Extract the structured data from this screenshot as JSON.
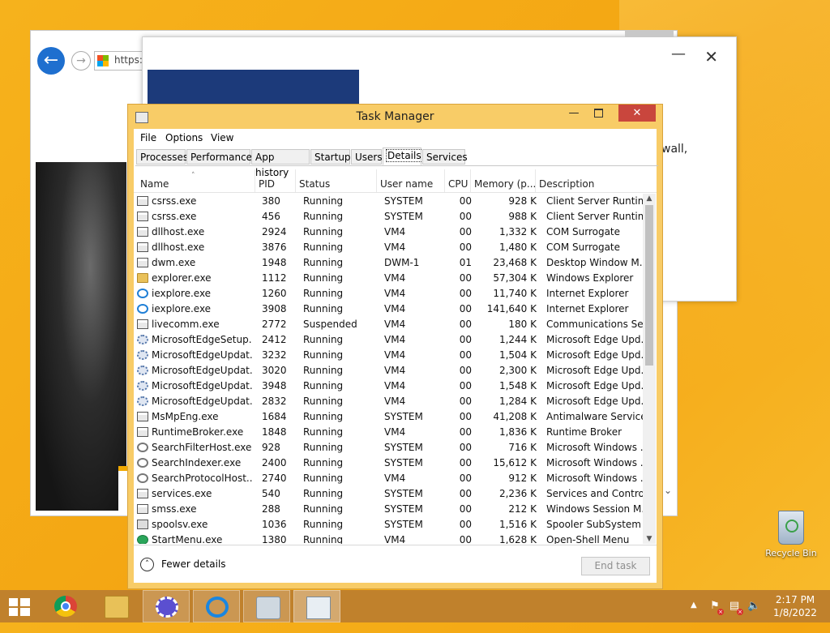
{
  "browser": {
    "address_text": "https:/",
    "dialog_snippet_text": "wall,"
  },
  "task_manager": {
    "title": "Task Manager",
    "menu": [
      "File",
      "Options",
      "View"
    ],
    "tabs": [
      "Processes",
      "Performance",
      "App history",
      "Startup",
      "Users",
      "Details",
      "Services"
    ],
    "active_tab": "Details",
    "columns": [
      "Name",
      "PID",
      "Status",
      "User name",
      "CPU",
      "Memory (p...",
      "Description"
    ],
    "rows": [
      {
        "name": "csrss.exe",
        "icon": "exe",
        "pid": "380",
        "status": "Running",
        "user": "SYSTEM",
        "cpu": "00",
        "mem": "928 K",
        "desc": "Client Server Runtim..."
      },
      {
        "name": "csrss.exe",
        "icon": "exe",
        "pid": "456",
        "status": "Running",
        "user": "SYSTEM",
        "cpu": "00",
        "mem": "988 K",
        "desc": "Client Server Runtim..."
      },
      {
        "name": "dllhost.exe",
        "icon": "exe",
        "pid": "2924",
        "status": "Running",
        "user": "VM4",
        "cpu": "00",
        "mem": "1,332 K",
        "desc": "COM Surrogate"
      },
      {
        "name": "dllhost.exe",
        "icon": "exe",
        "pid": "3876",
        "status": "Running",
        "user": "VM4",
        "cpu": "00",
        "mem": "1,480 K",
        "desc": "COM Surrogate"
      },
      {
        "name": "dwm.exe",
        "icon": "exe",
        "pid": "1948",
        "status": "Running",
        "user": "DWM-1",
        "cpu": "01",
        "mem": "23,468 K",
        "desc": "Desktop Window M..."
      },
      {
        "name": "explorer.exe",
        "icon": "folder",
        "pid": "1112",
        "status": "Running",
        "user": "VM4",
        "cpu": "00",
        "mem": "57,304 K",
        "desc": "Windows Explorer"
      },
      {
        "name": "iexplore.exe",
        "icon": "ie",
        "pid": "1260",
        "status": "Running",
        "user": "VM4",
        "cpu": "00",
        "mem": "11,740 K",
        "desc": "Internet Explorer"
      },
      {
        "name": "iexplore.exe",
        "icon": "ie",
        "pid": "3908",
        "status": "Running",
        "user": "VM4",
        "cpu": "00",
        "mem": "141,640 K",
        "desc": "Internet Explorer"
      },
      {
        "name": "livecomm.exe",
        "icon": "exe",
        "pid": "2772",
        "status": "Suspended",
        "user": "VM4",
        "cpu": "00",
        "mem": "180 K",
        "desc": "Communications Se..."
      },
      {
        "name": "MicrosoftEdgeSetup....",
        "icon": "gear",
        "pid": "2412",
        "status": "Running",
        "user": "VM4",
        "cpu": "00",
        "mem": "1,244 K",
        "desc": "Microsoft Edge Upd..."
      },
      {
        "name": "MicrosoftEdgeUpdat...",
        "icon": "gear",
        "pid": "3232",
        "status": "Running",
        "user": "VM4",
        "cpu": "00",
        "mem": "1,504 K",
        "desc": "Microsoft Edge Upd..."
      },
      {
        "name": "MicrosoftEdgeUpdat...",
        "icon": "gear",
        "pid": "3020",
        "status": "Running",
        "user": "VM4",
        "cpu": "00",
        "mem": "2,300 K",
        "desc": "Microsoft Edge Upd..."
      },
      {
        "name": "MicrosoftEdgeUpdat...",
        "icon": "gear",
        "pid": "3948",
        "status": "Running",
        "user": "VM4",
        "cpu": "00",
        "mem": "1,548 K",
        "desc": "Microsoft Edge Upd..."
      },
      {
        "name": "MicrosoftEdgeUpdat...",
        "icon": "gear",
        "pid": "2832",
        "status": "Running",
        "user": "VM4",
        "cpu": "00",
        "mem": "1,284 K",
        "desc": "Microsoft Edge Upd..."
      },
      {
        "name": "MsMpEng.exe",
        "icon": "exe",
        "pid": "1684",
        "status": "Running",
        "user": "SYSTEM",
        "cpu": "00",
        "mem": "41,208 K",
        "desc": "Antimalware Service..."
      },
      {
        "name": "RuntimeBroker.exe",
        "icon": "exe",
        "pid": "1848",
        "status": "Running",
        "user": "VM4",
        "cpu": "00",
        "mem": "1,836 K",
        "desc": "Runtime Broker"
      },
      {
        "name": "SearchFilterHost.exe",
        "icon": "search",
        "pid": "928",
        "status": "Running",
        "user": "SYSTEM",
        "cpu": "00",
        "mem": "716 K",
        "desc": "Microsoft Windows ..."
      },
      {
        "name": "SearchIndexer.exe",
        "icon": "search",
        "pid": "2400",
        "status": "Running",
        "user": "SYSTEM",
        "cpu": "00",
        "mem": "15,612 K",
        "desc": "Microsoft Windows ..."
      },
      {
        "name": "SearchProtocolHost....",
        "icon": "search",
        "pid": "2740",
        "status": "Running",
        "user": "VM4",
        "cpu": "00",
        "mem": "912 K",
        "desc": "Microsoft Windows ..."
      },
      {
        "name": "services.exe",
        "icon": "exe",
        "pid": "540",
        "status": "Running",
        "user": "SYSTEM",
        "cpu": "00",
        "mem": "2,236 K",
        "desc": "Services and Control..."
      },
      {
        "name": "smss.exe",
        "icon": "exe",
        "pid": "288",
        "status": "Running",
        "user": "SYSTEM",
        "cpu": "00",
        "mem": "212 K",
        "desc": "Windows Session M..."
      },
      {
        "name": "spoolsv.exe",
        "icon": "print",
        "pid": "1036",
        "status": "Running",
        "user": "SYSTEM",
        "cpu": "00",
        "mem": "1,516 K",
        "desc": "Spooler SubSystem ..."
      },
      {
        "name": "StartMenu.exe",
        "icon": "start",
        "pid": "1380",
        "status": "Running",
        "user": "VM4",
        "cpu": "00",
        "mem": "1,628 K",
        "desc": "Open-Shell Menu"
      }
    ],
    "footer": {
      "fewer_details": "Fewer details",
      "end_task": "End task"
    }
  },
  "desktop": {
    "recycle_bin_label": "Recycle Bin"
  },
  "taskbar": {
    "items": [
      "start-icon",
      "chrome-icon",
      "file-explorer-icon",
      "settings-gear-icon",
      "internet-explorer-icon",
      "setup-disc-icon",
      "task-manager-icon"
    ],
    "active_item": "task-manager-icon",
    "clock_time": "2:17 PM",
    "clock_date": "1/8/2022"
  },
  "colors": {
    "desktop_bg": "#f5a916",
    "taskbar_bg": "#c0812c",
    "window_frame": "#f8cc67",
    "close_button": "#c9463d",
    "ie_blue": "#1e6fcf"
  }
}
